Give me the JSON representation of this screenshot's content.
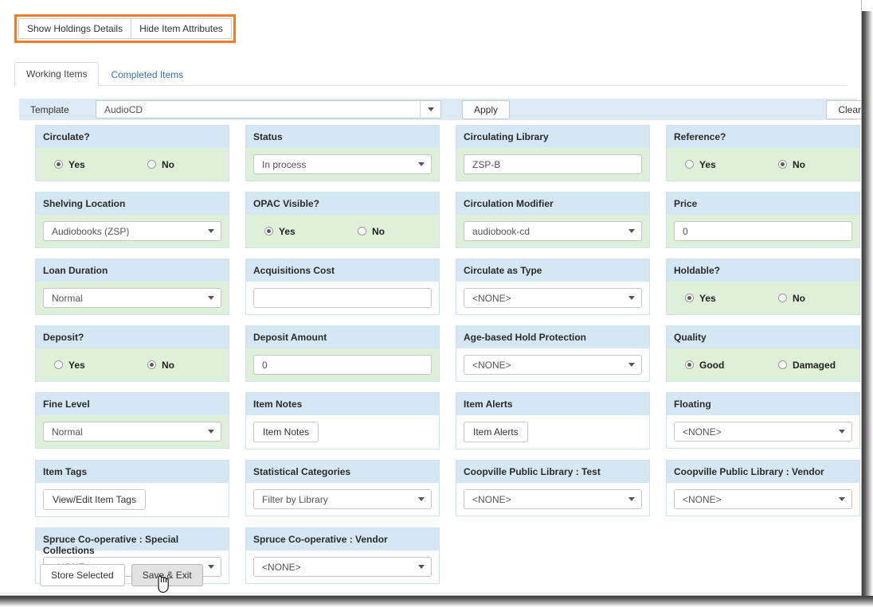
{
  "toolbar": {
    "show_holdings_label": "Show Holdings Details",
    "hide_attributes_label": "Hide Item Attributes",
    "highlight_color": "#f07d22"
  },
  "tabs": [
    {
      "label": "Working Items",
      "active": true
    },
    {
      "label": "Completed Items",
      "active": false
    }
  ],
  "template_bar": {
    "label": "Template",
    "value": "AudioCD",
    "apply_label": "Apply",
    "clear_label": "Clear",
    "bar_color": "#dbeaf5"
  },
  "fields": [
    [
      {
        "title": "Circulate?",
        "type": "radio",
        "body": "green",
        "options": [
          {
            "label": "Yes",
            "selected": true
          },
          {
            "label": "No",
            "selected": false
          }
        ]
      },
      {
        "title": "Status",
        "type": "select",
        "body": "green",
        "value": "In process"
      },
      {
        "title": "Circulating Library",
        "type": "text",
        "body": "green",
        "value": "ZSP-B"
      },
      {
        "title": "Reference?",
        "type": "radio",
        "body": "green",
        "options": [
          {
            "label": "Yes",
            "selected": false
          },
          {
            "label": "No",
            "selected": true
          }
        ]
      }
    ],
    [
      {
        "title": "Shelving Location",
        "type": "select",
        "body": "green",
        "value": "Audiobooks (ZSP)"
      },
      {
        "title": "OPAC Visible?",
        "type": "radio",
        "body": "green",
        "options": [
          {
            "label": "Yes",
            "selected": true
          },
          {
            "label": "No",
            "selected": false
          }
        ]
      },
      {
        "title": "Circulation Modifier",
        "type": "select",
        "body": "green",
        "value": "audiobook-cd"
      },
      {
        "title": "Price",
        "type": "text",
        "body": "green",
        "value": "0"
      }
    ],
    [
      {
        "title": "Loan Duration",
        "type": "select",
        "body": "green",
        "value": "Normal"
      },
      {
        "title": "Acquisitions Cost",
        "type": "text",
        "body": "white",
        "value": ""
      },
      {
        "title": "Circulate as Type",
        "type": "select",
        "body": "white",
        "value": "<NONE>"
      },
      {
        "title": "Holdable?",
        "type": "radio",
        "body": "green",
        "options": [
          {
            "label": "Yes",
            "selected": true
          },
          {
            "label": "No",
            "selected": false
          }
        ]
      }
    ],
    [
      {
        "title": "Deposit?",
        "type": "radio",
        "body": "green",
        "options": [
          {
            "label": "Yes",
            "selected": false
          },
          {
            "label": "No",
            "selected": true
          }
        ]
      },
      {
        "title": "Deposit Amount",
        "type": "text",
        "body": "green",
        "value": "0"
      },
      {
        "title": "Age-based Hold Protection",
        "type": "select",
        "body": "white",
        "value": "<NONE>"
      },
      {
        "title": "Quality",
        "type": "radio",
        "body": "green",
        "options": [
          {
            "label": "Good",
            "selected": true
          },
          {
            "label": "Damaged",
            "selected": false
          }
        ]
      }
    ],
    [
      {
        "title": "Fine Level",
        "type": "select",
        "body": "green",
        "value": "Normal"
      },
      {
        "title": "Item Notes",
        "type": "button",
        "body": "white",
        "value": "Item Notes"
      },
      {
        "title": "Item Alerts",
        "type": "button",
        "body": "white",
        "value": "Item Alerts"
      },
      {
        "title": "Floating",
        "type": "select",
        "body": "white",
        "value": "<NONE>"
      }
    ],
    [
      {
        "title": "Item Tags",
        "type": "button",
        "body": "white",
        "value": "View/Edit Item Tags"
      },
      {
        "title": "Statistical Categories",
        "type": "select",
        "body": "white",
        "value": "Filter by Library"
      },
      {
        "title": "Coopville Public Library : Test",
        "type": "select",
        "body": "white",
        "value": "<NONE>"
      },
      {
        "title": "Coopville Public Library : Vendor",
        "type": "select",
        "body": "white",
        "value": "<NONE>"
      }
    ],
    [
      {
        "title": "Spruce Co-operative : Special Collections",
        "type": "select",
        "body": "white",
        "value": "<NONE>"
      },
      {
        "title": "Spruce Co-operative : Vendor",
        "type": "select",
        "body": "white",
        "value": "<NONE>"
      }
    ]
  ],
  "footer": {
    "store_selected_label": "Store Selected",
    "save_exit_label": "Save & Exit"
  }
}
